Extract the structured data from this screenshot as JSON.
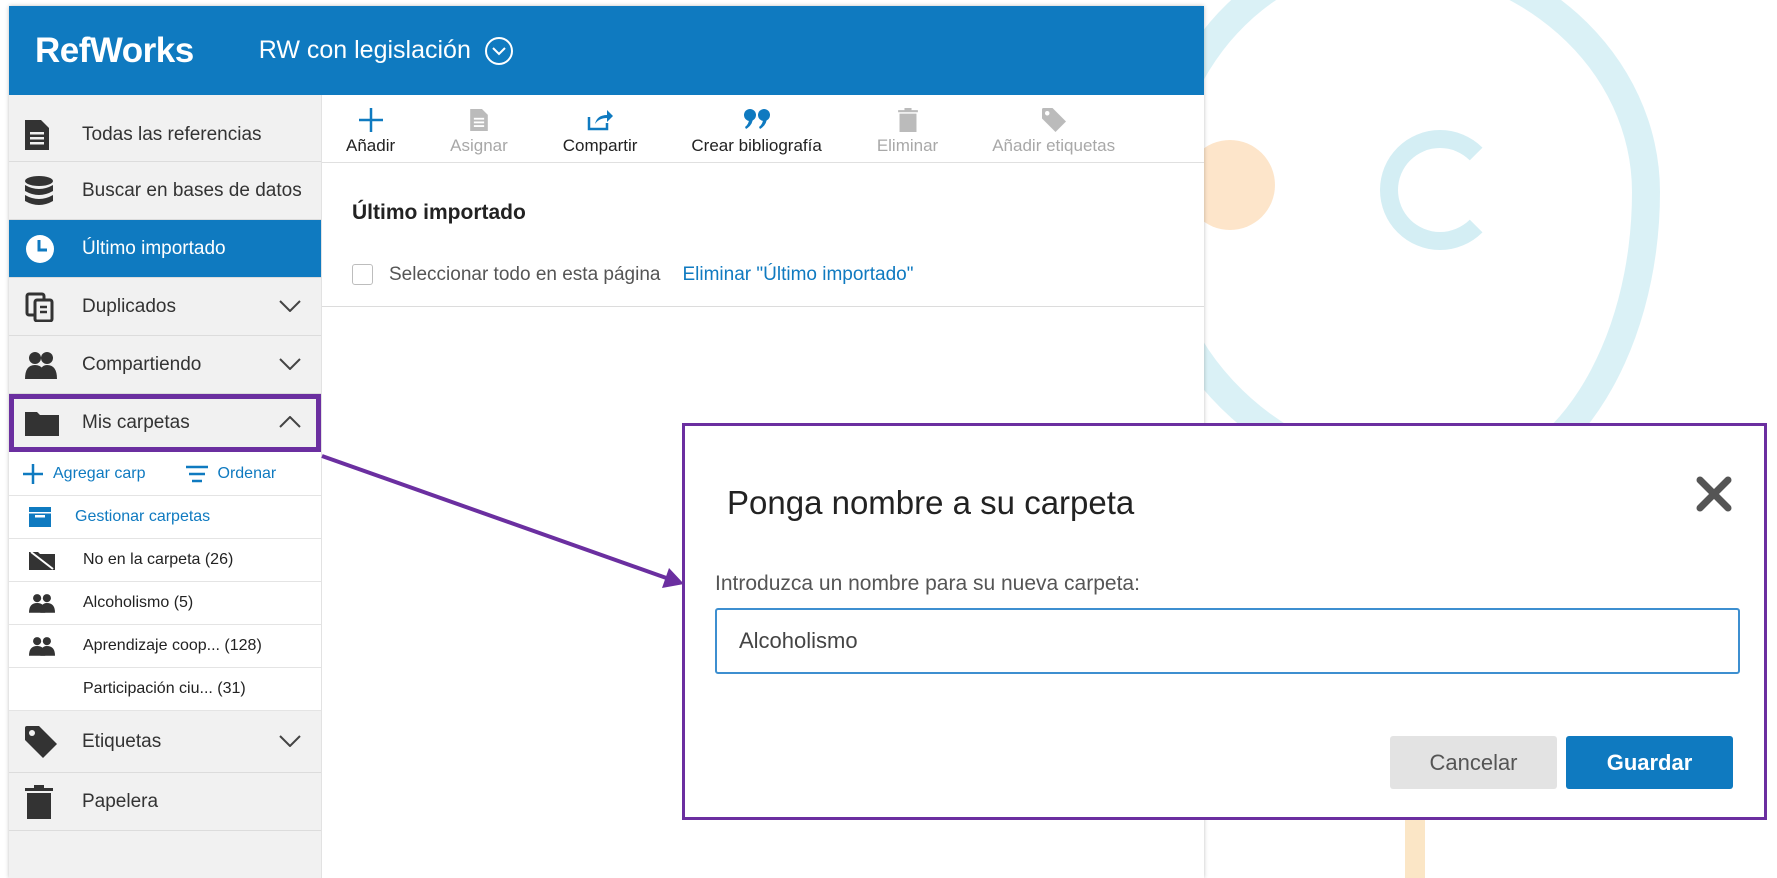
{
  "header": {
    "logo": "RefWorks",
    "project": "RW con legislación"
  },
  "sidebar": {
    "items": [
      {
        "label": "Todas las referencias",
        "icon": "document-icon"
      },
      {
        "label": "Buscar en bases de datos",
        "icon": "database-icon"
      },
      {
        "label": "Último importado",
        "icon": "clock-icon",
        "active": true
      },
      {
        "label": "Duplicados",
        "icon": "duplicates-icon",
        "expand": "chevron-down"
      },
      {
        "label": "Compartiendo",
        "icon": "users-icon",
        "expand": "chevron-down"
      },
      {
        "label": "Mis carpetas",
        "icon": "folder-icon",
        "expand": "chevron-up",
        "highlighted": true
      },
      {
        "label": "Etiquetas",
        "icon": "tag-icon",
        "expand": "chevron-down"
      },
      {
        "label": "Papelera",
        "icon": "trash-icon"
      }
    ],
    "folder_actions": {
      "add": "Agregar carp",
      "sort": "Ordenar"
    },
    "folders": [
      {
        "label": "Gestionar carpetas",
        "icon": "archive-icon"
      },
      {
        "label": "No en la carpeta (26)",
        "icon": "unfiled-folder-icon"
      },
      {
        "label": "Alcoholismo (5)",
        "icon": "shared-users-icon"
      },
      {
        "label": "Aprendizaje coop... (128)",
        "icon": "shared-users-icon"
      },
      {
        "label": "Participación ciu... (31)",
        "icon": ""
      }
    ]
  },
  "toolbar": {
    "items": [
      {
        "label": "Añadir",
        "icon": "plus-icon",
        "enabled": true
      },
      {
        "label": "Asignar",
        "icon": "document-icon",
        "enabled": false
      },
      {
        "label": "Compartir",
        "icon": "share-icon",
        "enabled": true
      },
      {
        "label": "Crear bibliografía",
        "icon": "quote-icon",
        "enabled": true
      },
      {
        "label": "Eliminar",
        "icon": "trash-icon",
        "enabled": false
      },
      {
        "label": "Añadir etiquetas",
        "icon": "tag-icon",
        "enabled": false
      }
    ]
  },
  "main": {
    "title": "Último importado",
    "select_all": "Seleccionar todo en esta página",
    "delete_link": "Eliminar \"Último importado\""
  },
  "dialog": {
    "title": "Ponga nombre a su carpeta",
    "label": "Introduzca un nombre para su nueva carpeta:",
    "value": "Alcoholismo",
    "cancel": "Cancelar",
    "save": "Guardar"
  },
  "colors": {
    "brand": "#0f7ac0",
    "highlight": "#6b2fa0"
  }
}
